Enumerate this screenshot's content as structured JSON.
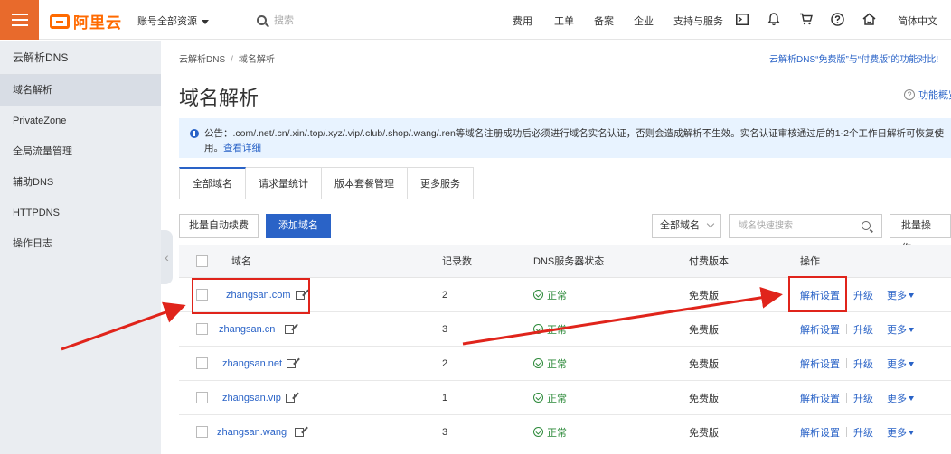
{
  "topbar": {
    "logo_text": "阿里云",
    "account": "账号全部资源",
    "search_placeholder": "搜索",
    "nav": [
      "费用",
      "工单",
      "备案",
      "企业",
      "支持与服务"
    ],
    "language": "简体中文"
  },
  "sidebar": {
    "title": "云解析DNS",
    "items": [
      {
        "label": "域名解析",
        "active": true
      },
      {
        "label": "PrivateZone",
        "active": false
      },
      {
        "label": "全局流量管理",
        "active": false
      },
      {
        "label": "辅助DNS",
        "active": false
      },
      {
        "label": "HTTPDNS",
        "active": false
      },
      {
        "label": "操作日志",
        "active": false
      }
    ]
  },
  "breadcrumb": {
    "root": "云解析DNS",
    "sep": "/",
    "current": "域名解析"
  },
  "compare_link": "云解析DNS“免费版”与“付费版”的功能对比!",
  "page_title": "域名解析",
  "help_link": "功能概览",
  "notice": {
    "text": "公告：.com/.net/.cn/.xin/.top/.xyz/.vip/.club/.shop/.wang/.ren等域名注册成功后必须进行域名实名认证，否则会造成解析不生效。实名认证审核通过后的1-2个工作日解析可恢复使用。",
    "link": "查看详细"
  },
  "tabs": [
    "全部域名",
    "请求量统计",
    "版本套餐管理",
    "更多服务"
  ],
  "toolbar": {
    "batch_renew": "批量自动续费",
    "add_domain": "添加域名",
    "filter_select": "全部域名",
    "search_placeholder": "域名快速搜索",
    "batch_ops": "批量操作"
  },
  "table": {
    "headers": {
      "domain": "域名",
      "records": "记录数",
      "dns_status": "DNS服务器状态",
      "edition": "付费版本",
      "ops": "操作"
    },
    "rows": [
      {
        "domain": "zhangsan.com",
        "records": "2",
        "status": "正常",
        "edition": "免费版"
      },
      {
        "domain": "zhangsan.cn",
        "records": "3",
        "status": "正常",
        "edition": "免费版"
      },
      {
        "domain": "zhangsan.net",
        "records": "2",
        "status": "正常",
        "edition": "免费版"
      },
      {
        "domain": "zhangsan.vip",
        "records": "1",
        "status": "正常",
        "edition": "免费版"
      },
      {
        "domain": "zhangsan.wang",
        "records": "3",
        "status": "正常",
        "edition": "免费版"
      }
    ],
    "op_labels": {
      "settings": "解析设置",
      "upgrade": "升级",
      "more": "更多"
    }
  },
  "colors": {
    "brand": "#ff6a00",
    "primary": "#2a63c7",
    "highlight": "#e0241b",
    "ok": "#2d8a3a"
  }
}
